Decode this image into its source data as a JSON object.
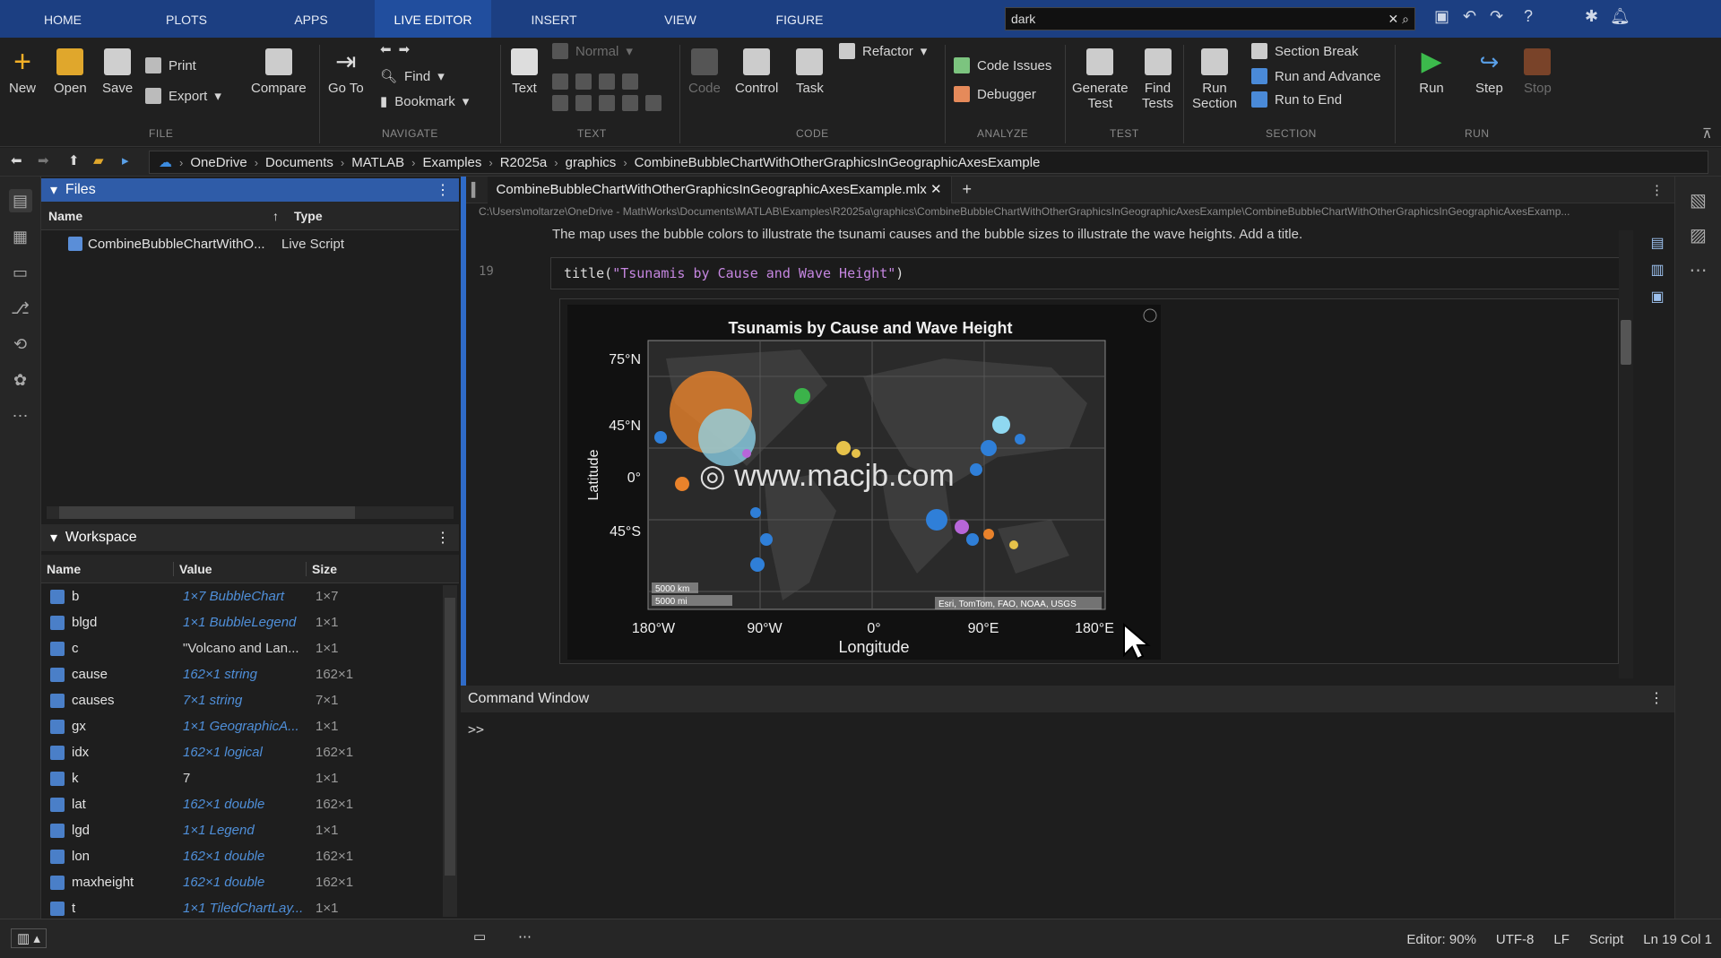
{
  "tabs": [
    "HOME",
    "PLOTS",
    "APPS",
    "LIVE EDITOR",
    "INSERT",
    "VIEW",
    "FIGURE"
  ],
  "search": {
    "value": "dark"
  },
  "ribbon": {
    "file": {
      "new": "New",
      "open": "Open",
      "save": "Save",
      "print": "Print",
      "export": "Export",
      "compare": "Compare",
      "group": "FILE"
    },
    "navigate": {
      "goto": "Go To",
      "find": "Find",
      "bookmark": "Bookmark",
      "group": "NAVIGATE"
    },
    "text": {
      "text": "Text",
      "style": "Normal",
      "group": "TEXT"
    },
    "code": {
      "code": "Code",
      "control": "Control",
      "task": "Task",
      "refactor": "Refactor",
      "group": "CODE"
    },
    "analyze": {
      "issues": "Code Issues",
      "debugger": "Debugger",
      "group": "ANALYZE"
    },
    "test": {
      "generate": "Generate",
      "generate2": "Test",
      "find": "Find",
      "find2": "Tests",
      "group": "TEST"
    },
    "section": {
      "run": "Run",
      "run2": "Section",
      "break": "Section Break",
      "runadv": "Run and Advance",
      "runend": "Run to End",
      "group": "SECTION"
    },
    "run": {
      "run": "Run",
      "step": "Step",
      "stop": "Stop",
      "group": "RUN"
    }
  },
  "breadcrumb": [
    "OneDrive",
    "Documents",
    "MATLAB",
    "Examples",
    "R2025a",
    "graphics",
    "CombineBubbleChartWithOtherGraphicsInGeographicAxesExample"
  ],
  "files": {
    "title": "Files",
    "col_name": "Name",
    "col_type": "Type",
    "item_name": "CombineBubbleChartWithO...",
    "item_type": "Live Script"
  },
  "workspace": {
    "title": "Workspace",
    "col_name": "Name",
    "col_value": "Value",
    "col_size": "Size",
    "rows": [
      {
        "name": "b",
        "value": "1×7 BubbleChart",
        "size": "1×7",
        "plain": false
      },
      {
        "name": "blgd",
        "value": "1×1 BubbleLegend",
        "size": "1×1",
        "plain": false
      },
      {
        "name": "c",
        "value": "\"Volcano and Lan...",
        "size": "1×1",
        "plain": true
      },
      {
        "name": "cause",
        "value": "162×1 string",
        "size": "162×1",
        "plain": false
      },
      {
        "name": "causes",
        "value": "7×1 string",
        "size": "7×1",
        "plain": false
      },
      {
        "name": "gx",
        "value": "1×1 GeographicA...",
        "size": "1×1",
        "plain": false
      },
      {
        "name": "idx",
        "value": "162×1 logical",
        "size": "162×1",
        "plain": false
      },
      {
        "name": "k",
        "value": "7",
        "size": "1×1",
        "plain": true
      },
      {
        "name": "lat",
        "value": "162×1 double",
        "size": "162×1",
        "plain": false
      },
      {
        "name": "lgd",
        "value": "1×1 Legend",
        "size": "1×1",
        "plain": false
      },
      {
        "name": "lon",
        "value": "162×1 double",
        "size": "162×1",
        "plain": false
      },
      {
        "name": "maxheight",
        "value": "162×1 double",
        "size": "162×1",
        "plain": false
      },
      {
        "name": "t",
        "value": "1×1 TiledChartLay...",
        "size": "1×1",
        "plain": false
      }
    ]
  },
  "editor": {
    "tab": "CombineBubbleChartWithOtherGraphicsInGeographicAxesExample.mlx",
    "path": "C:\\Users\\moltarze\\OneDrive - MathWorks\\Documents\\MATLAB\\Examples\\R2025a\\graphics\\CombineBubbleChartWithOtherGraphicsInGeographicAxesExample\\CombineBubbleChartWithOtherGraphicsInGeographicAxesExamp...",
    "desc": "The map uses the bubble colors to illustrate the tsunami causes and the bubble sizes to illustrate the wave heights. Add a title.",
    "line": "19",
    "code_fn": "title(",
    "code_str": "\"Tsunamis by Cause and Wave Height\"",
    "code_end": ")"
  },
  "figure": {
    "title": "Tsunamis by Cause and Wave Height",
    "xlabel": "Longitude",
    "ylabel": "Latitude",
    "yticks": [
      "75°N",
      "45°N",
      "0°",
      "45°S"
    ],
    "xticks": [
      "180°W",
      "90°W",
      "0°",
      "90°E",
      "180°E"
    ],
    "scale_km": "5000 km",
    "scale_mi": "5000 mi",
    "attribution": "Esri, TomTom, FAO, NOAA, USGS"
  },
  "watermark": "www.macjb.com",
  "command": {
    "title": "Command Window",
    "prompt": ">>"
  },
  "status": {
    "editor": "Editor: 90%",
    "encoding": "UTF-8",
    "eol": "LF",
    "type": "Script",
    "pos": "Ln 19 Col 1"
  }
}
